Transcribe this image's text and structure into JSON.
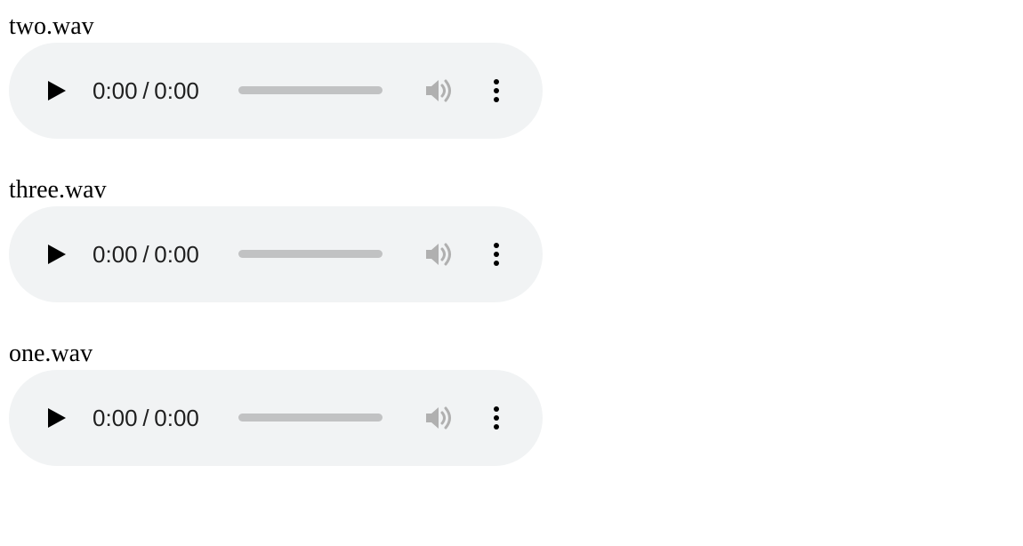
{
  "tracks": [
    {
      "filename": "two.wav",
      "current_time": "0:00",
      "separator": "/",
      "duration": "0:00",
      "progress": 0
    },
    {
      "filename": "three.wav",
      "current_time": "0:00",
      "separator": "/",
      "duration": "0:00",
      "progress": 0
    },
    {
      "filename": "one.wav",
      "current_time": "0:00",
      "separator": "/",
      "duration": "0:00",
      "progress": 0
    }
  ],
  "icons": {
    "play": "play-icon",
    "volume": "volume-icon",
    "menu": "more-vertical-icon"
  },
  "colors": {
    "player_background": "#f1f3f4",
    "seek_track": "#c1c2c3",
    "icon_dark": "#000000",
    "icon_muted": "#b0b0b0",
    "time_text": "#1f1f1f"
  }
}
